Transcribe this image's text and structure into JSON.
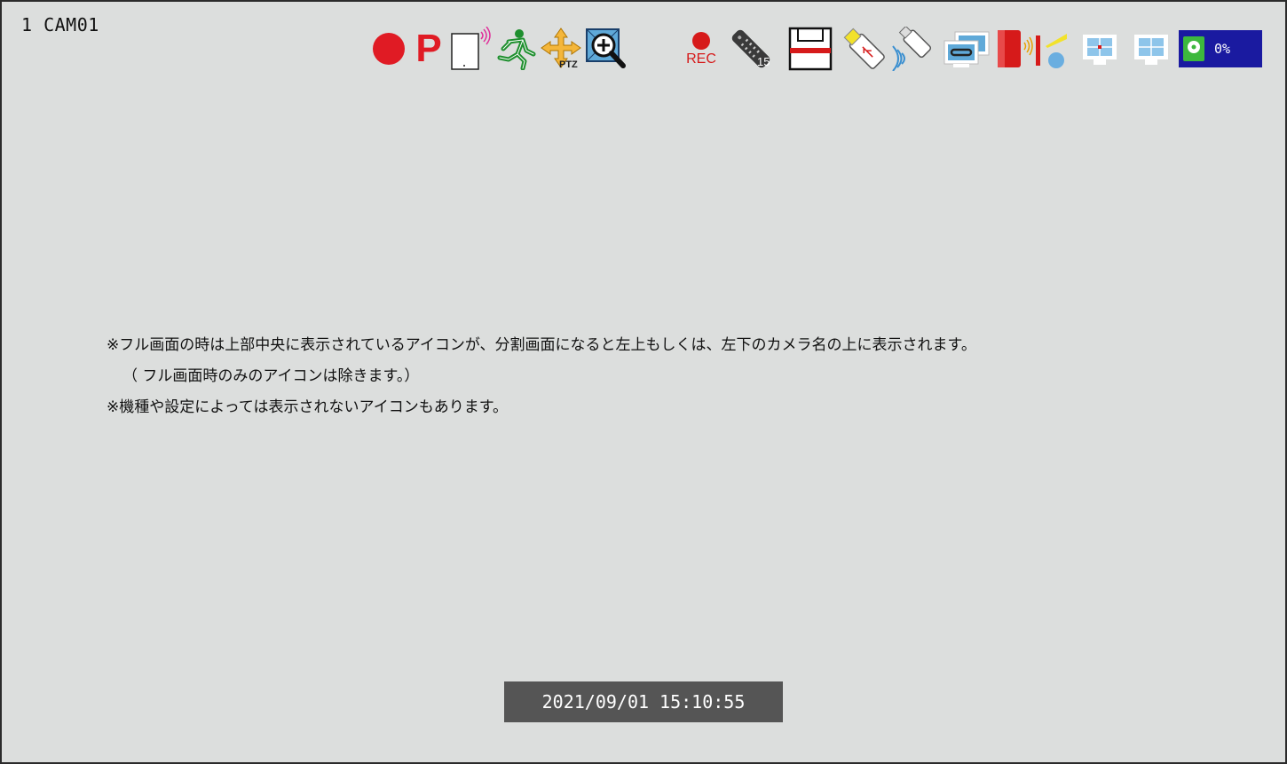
{
  "camera": {
    "label": "1 CAM01"
  },
  "status_icons": {
    "record_dot": "record-icon",
    "p_letter": "P",
    "rec_label": "REC",
    "remote_number": "15",
    "hdd_percent": "0%"
  },
  "notice": {
    "line1": "※フル画面の時は上部中央に表示されているアイコンが、分割画面になると左上もしくは、左下のカメラ名の上に表示されます。",
    "line2": "（ フル画面時のみのアイコンは除きます。）",
    "line3": "※機種や設定によっては表示されないアイコンもあります。"
  },
  "timestamp": "2021/09/01 15:10:55",
  "colors": {
    "background": "#dcdedd",
    "record_red": "#e01b24",
    "hdd_blue": "#1a1aa0",
    "timestamp_bg": "#555555"
  }
}
